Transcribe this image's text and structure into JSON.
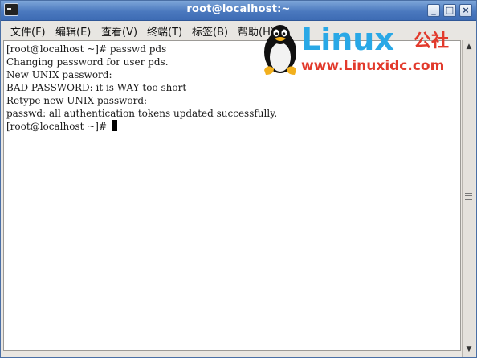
{
  "window": {
    "title": "root@localhost:~",
    "buttons": {
      "minimize": "_",
      "maximize": "□",
      "close": "×"
    }
  },
  "menu": {
    "items": [
      "文件(F)",
      "编辑(E)",
      "查看(V)",
      "终端(T)",
      "标签(B)",
      "帮助(H)"
    ]
  },
  "terminal": {
    "lines": [
      "[root@localhost ~]# passwd pds",
      "Changing password for user pds.",
      "New UNIX password:",
      "BAD PASSWORD: it is WAY too short",
      "Retype new UNIX password:",
      "passwd: all authentication tokens updated successfully.",
      "[root@localhost ~]# "
    ]
  },
  "watermark": {
    "brand": "Linux",
    "brand_suffix": "公社",
    "url": "www.Linuxidc.com",
    "icon": "tux-penguin-icon",
    "colors": {
      "blue": "#29a8e6",
      "red": "#e23a2c"
    }
  },
  "colors": {
    "titlebar": "#4b79bf",
    "terminal_bg": "#ffffff",
    "terminal_fg": "#1a1a1a"
  }
}
